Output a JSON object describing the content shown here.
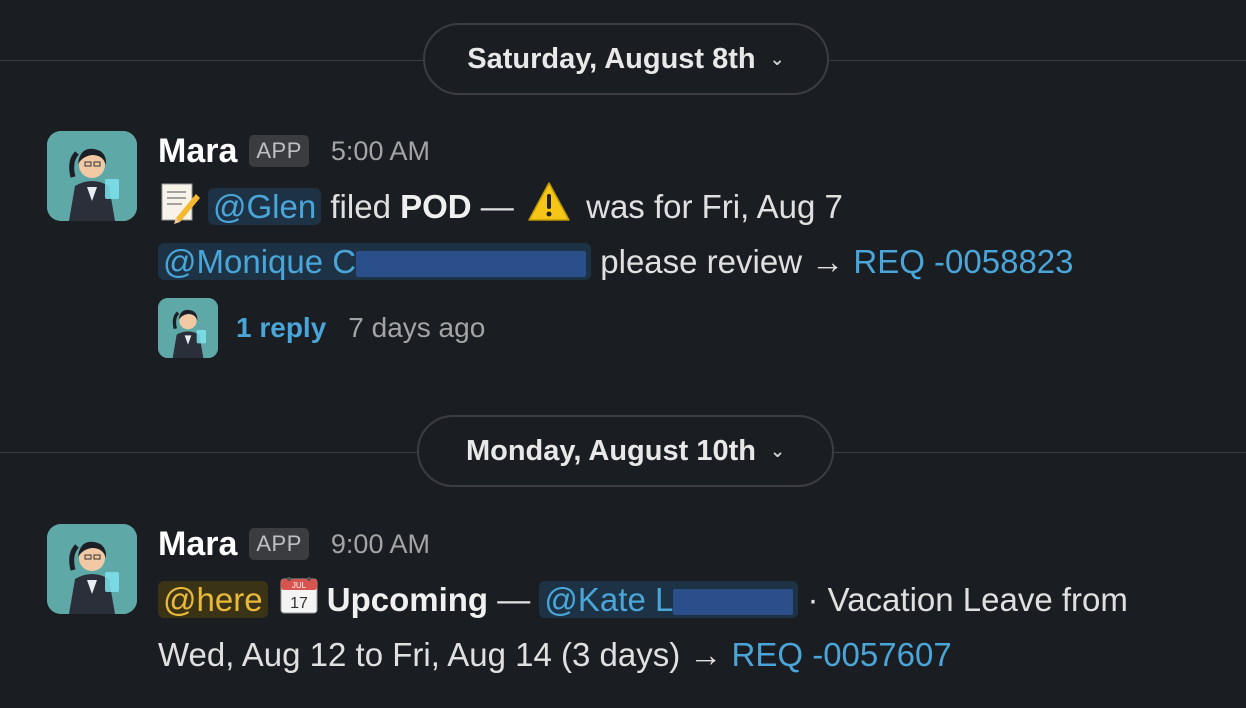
{
  "dividers": [
    {
      "label": "Saturday, August 8th",
      "icon": "chevron-down-icon"
    },
    {
      "label": "Monday, August 10th",
      "icon": "chevron-down-icon"
    }
  ],
  "messages": [
    {
      "sender": "Mara",
      "badge": "APP",
      "time": "5:00 AM",
      "line1": {
        "emoji": "memo-icon",
        "mention": "@Glen",
        "text1": " filed ",
        "bold": "POD",
        "text2": " — ",
        "emoji2": "warning-icon",
        "text3": " was for Fri, Aug 7"
      },
      "line2": {
        "mention": "@Monique C",
        "text": " please review → ",
        "link": "REQ -0058823"
      },
      "thread": {
        "reply": "1 reply",
        "ago": "7 days ago"
      }
    },
    {
      "sender": "Mara",
      "badge": "APP",
      "time": "9:00 AM",
      "line1": {
        "here": "@here",
        "emoji": "calendar-icon",
        "calendar_month": "JUL",
        "calendar_day": "17",
        "bold": "Upcoming",
        "text1": " — ",
        "mention": "@Kate L",
        "text2": " · Vacation Leave from"
      },
      "line2": {
        "text": "Wed, Aug 12 to Fri, Aug 14 (3 days) → ",
        "link": "REQ -0057607"
      }
    }
  ],
  "colors": {
    "background": "#1a1d21",
    "link": "#4aa5d8",
    "here": "#e8b93a",
    "redaction": "#2a4f8a"
  }
}
